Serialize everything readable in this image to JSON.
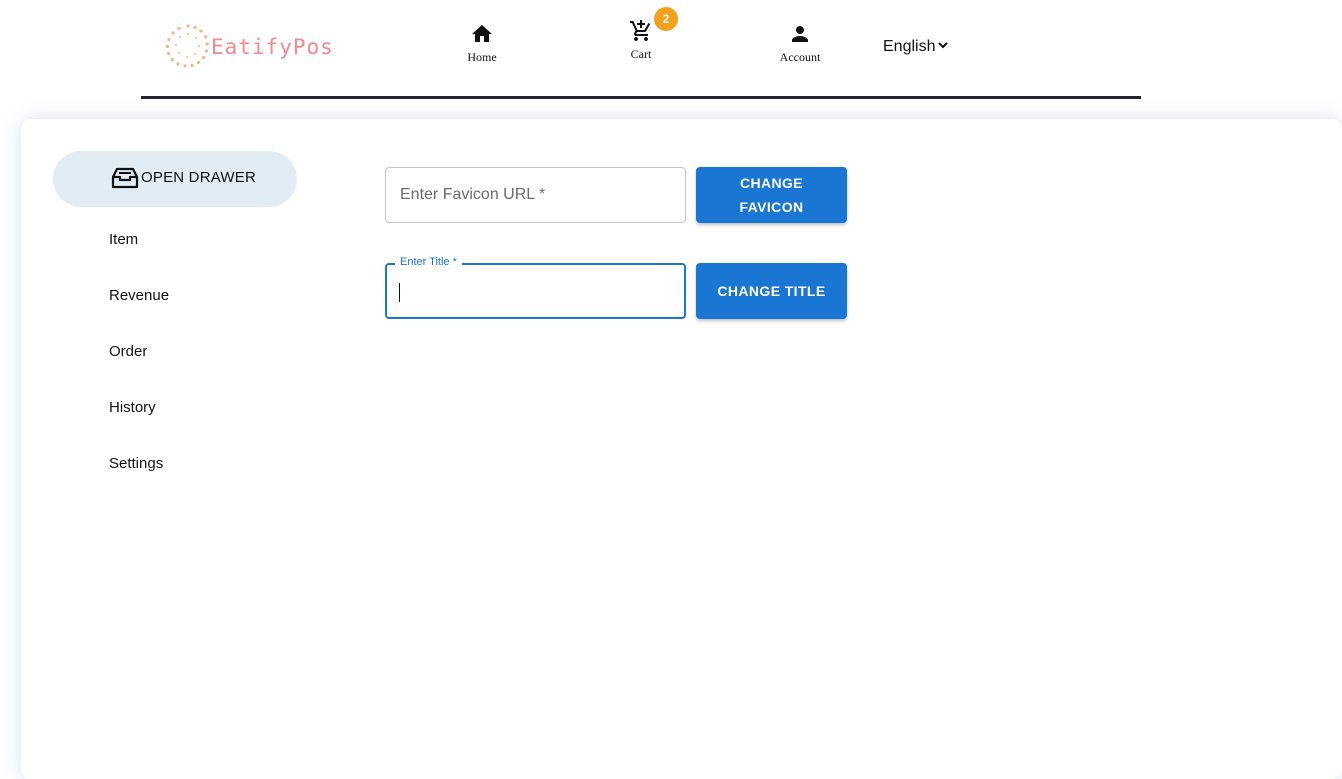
{
  "header": {
    "logo_text": "EatifyPos",
    "nav": {
      "home_label": "Home",
      "cart_label": "Cart",
      "cart_count": "2",
      "account_label": "Account"
    },
    "language": "English",
    "icons": {
      "home": "home-icon",
      "cart": "cart-icon",
      "account": "person-icon",
      "language_toggle": "chevron-down-icon",
      "logo_mark": "sunburst-dots-icon"
    }
  },
  "sidebar": {
    "drawer_label": "OPEN DRAWER",
    "drawer_icon": "tray-icon",
    "items": [
      {
        "label": "Item"
      },
      {
        "label": "Revenue"
      },
      {
        "label": "Order"
      },
      {
        "label": "History"
      },
      {
        "label": "Settings"
      }
    ]
  },
  "form": {
    "favicon": {
      "placeholder": "Enter Favicon URL *",
      "value": "",
      "button_label": "CHANGE FAVICON"
    },
    "title": {
      "label": "Enter Title *",
      "value": "",
      "button_label": "CHANGE TITLE"
    }
  },
  "colors": {
    "primary": "#1976d2",
    "badge": "#f5a11b",
    "logo_text": "#f08a8e",
    "drawer_bg": "#e2ecf5",
    "header_rule": "#23262b"
  }
}
